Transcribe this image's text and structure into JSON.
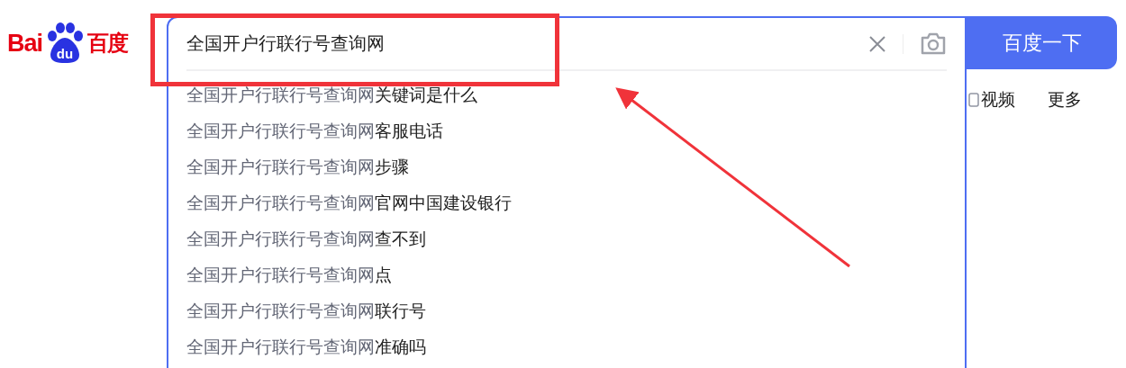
{
  "logo": {
    "left": "Bai",
    "paw": "du",
    "right": "百度"
  },
  "search": {
    "value": "全国开户行联行号查询网"
  },
  "search_button": {
    "label": "百度一下"
  },
  "suggestions": [
    {
      "prefix": "全国开户行联行号查询网",
      "suffix": "关键词是什么"
    },
    {
      "prefix": "全国开户行联行号查询网",
      "suffix": "客服电话"
    },
    {
      "prefix": "全国开户行联行号查询网",
      "suffix": "步骤"
    },
    {
      "prefix": "全国开户行联行号查询网",
      "suffix": "官网中国建设银行"
    },
    {
      "prefix": "全国开户行联行号查询网",
      "suffix": "查不到"
    },
    {
      "prefix": "全国开户行联行号查询网",
      "suffix": "点"
    },
    {
      "prefix": "全国开户行联行号查询网",
      "suffix": "联行号"
    },
    {
      "prefix": "全国开户行联行号查询网",
      "suffix": "准确吗"
    }
  ],
  "tabs": [
    {
      "label": "视频",
      "kind": "icon"
    },
    {
      "label": "更多",
      "kind": "plain"
    }
  ]
}
